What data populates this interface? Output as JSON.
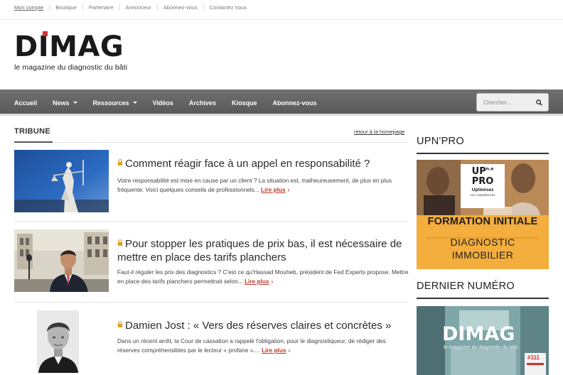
{
  "topnav": [
    "Mon compte",
    "Boutique",
    "Partenaire",
    "Annonceur",
    "Abonnez-vous",
    "Contactez nous"
  ],
  "logo": {
    "word": "DIMAG",
    "tagline": "le magazine du diagnostic du bâti"
  },
  "nav": {
    "items": [
      {
        "label": "Accueil",
        "dropdown": false
      },
      {
        "label": "News",
        "dropdown": true
      },
      {
        "label": "Ressources",
        "dropdown": true
      },
      {
        "label": "Vidéos",
        "dropdown": false
      },
      {
        "label": "Archives",
        "dropdown": false
      },
      {
        "label": "Kiosque",
        "dropdown": false
      },
      {
        "label": "Abonnez-vous",
        "dropdown": false
      }
    ],
    "search_placeholder": "Chercher..."
  },
  "section": {
    "title": "TRIBUNE",
    "home_link": "retour à la homepage"
  },
  "articles": [
    {
      "title": "Comment réagir face à un appel en responsabilité ?",
      "excerpt": "Votre responsabilité est mise en cause par un client ? La situation est, malheureusement, de plus en plus fréquente. Voici quelques conseils de professionnels...",
      "more": "Lire plus",
      "locked": true
    },
    {
      "title": "Pour stopper les pratiques de prix bas, il est nécessaire de mettre en place des tarifs planchers",
      "excerpt": "Faut-il réguler les prix des diagnostics ? C'est ce qu'Hassad Mouheb, président de Fed Experts propose. Mettre en place des tarifs planchers permettrait selon...",
      "more": "Lire plus",
      "locked": true
    },
    {
      "title": "Damien Jost : « Vers des réserves claires et concrètes »",
      "excerpt": "Dans un récent arrêt, la Cour de cassation a rappelé l'obligation, pour le diagnostiqueur, de rédiger des réserves compréhensibles par le lecteur « profane »....",
      "more": "Lire plus",
      "locked": true
    }
  ],
  "sidebar": {
    "upn_title": "UPN'PRO",
    "ad": {
      "logo_top": "UP",
      "logo_sup": "n.e",
      "logo_bottom": "PRO",
      "logo_tag": "Uptimisez",
      "logo_sub": "vos compétences",
      "headline": "FORMATION INITIALE",
      "line1": "DIAGNOSTIC",
      "line2": "IMMOBILIER"
    },
    "last_issue_title": "DERNIER NUMÉRO",
    "cover": {
      "word": "DIMAG",
      "tagline": "le magazine du diagnostic du bâti",
      "issue": "#111"
    }
  },
  "colors": {
    "accent": "#d0312d",
    "link_more": "#c0392b",
    "ad_bg": "#f4ae3d",
    "nav_bg": "#626262"
  }
}
